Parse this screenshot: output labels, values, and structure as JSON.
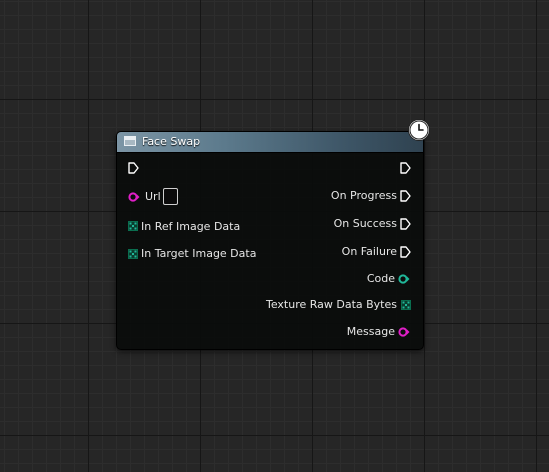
{
  "node": {
    "title": "Face Swap",
    "inputs": {
      "url": "Url",
      "in_ref": "In Ref Image Data",
      "in_target": "In Target Image Data"
    },
    "outputs": {
      "on_progress": "On Progress",
      "on_success": "On Success",
      "on_failure": "On Failure",
      "code": "Code",
      "texture": "Texture Raw Data Bytes",
      "message": "Message"
    }
  },
  "colors": {
    "string_pin": "#e11fc8",
    "int_pin": "#20b89a",
    "byte_array_pin": "#0a6e4f",
    "exec_pin": "#ffffff",
    "header_accent": "#5c7a8c"
  },
  "icons": [
    "node-function-icon",
    "latent-clock-icon"
  ]
}
